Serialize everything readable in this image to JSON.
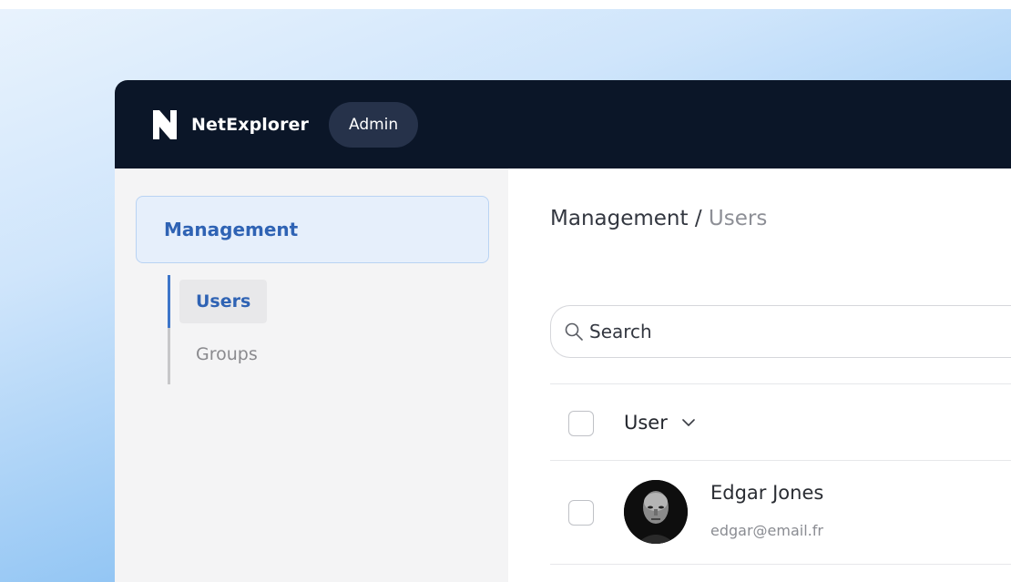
{
  "header": {
    "brand": "NetExplorer",
    "role_badge": "Admin",
    "logo_icon": "netexplorer-logo-icon"
  },
  "sidebar": {
    "section_label": "Management",
    "items": [
      {
        "label": "Users",
        "active": true
      },
      {
        "label": "Groups",
        "active": false
      }
    ]
  },
  "main": {
    "breadcrumb": {
      "parent": "Management",
      "separator": " / ",
      "current": "Users"
    },
    "search": {
      "placeholder": "Search",
      "icon": "search-icon"
    },
    "table": {
      "column_user": "User",
      "sort_icon": "chevron-down-icon",
      "rows": [
        {
          "name": "Edgar Jones",
          "email": "edgar@email.fr",
          "checked": false
        }
      ]
    }
  },
  "colors": {
    "topbar": "#0b1628",
    "accent": "#2f63b4",
    "sidebar_bg": "#f4f4f5"
  }
}
